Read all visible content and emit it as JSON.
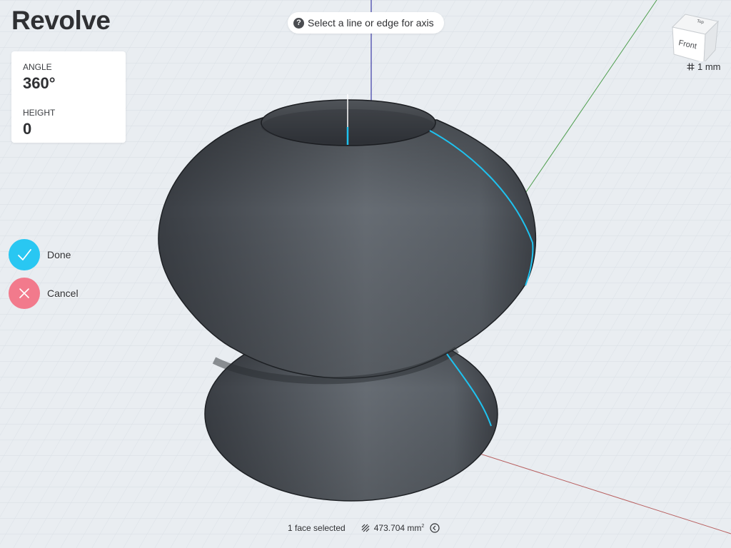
{
  "tool": {
    "title": "Revolve"
  },
  "parameters": {
    "angle_label": "ANGLE",
    "angle_value": "360°",
    "height_label": "HEIGHT",
    "height_value": "0"
  },
  "hint": {
    "icon": "question-icon",
    "icon_glyph": "?",
    "text": "Select a line or edge for axis"
  },
  "actions": {
    "done_label": "Done",
    "cancel_label": "Cancel",
    "done_color": "#29c7f2",
    "cancel_color": "#f27a8c"
  },
  "view_cube": {
    "front_label": "Front",
    "top_label": "Top"
  },
  "grid": {
    "scale_label": "1 mm",
    "icon": "grid-icon"
  },
  "status": {
    "selection": "1 face selected",
    "area_value": "473.704 mm",
    "area_exponent": "2",
    "area_icon": "hatch-area-icon",
    "collapse_icon": "chevron-left-circle-icon"
  },
  "colors": {
    "background": "#e9edf1",
    "grid_line": "#d6dde4",
    "axis_x": "#b86060",
    "axis_y": "#4e9e4e",
    "axis_z": "#3c3ca6",
    "selection_edge": "#1fc2ef",
    "body_dark": "#3b3f45",
    "body_light": "#6b7178"
  }
}
